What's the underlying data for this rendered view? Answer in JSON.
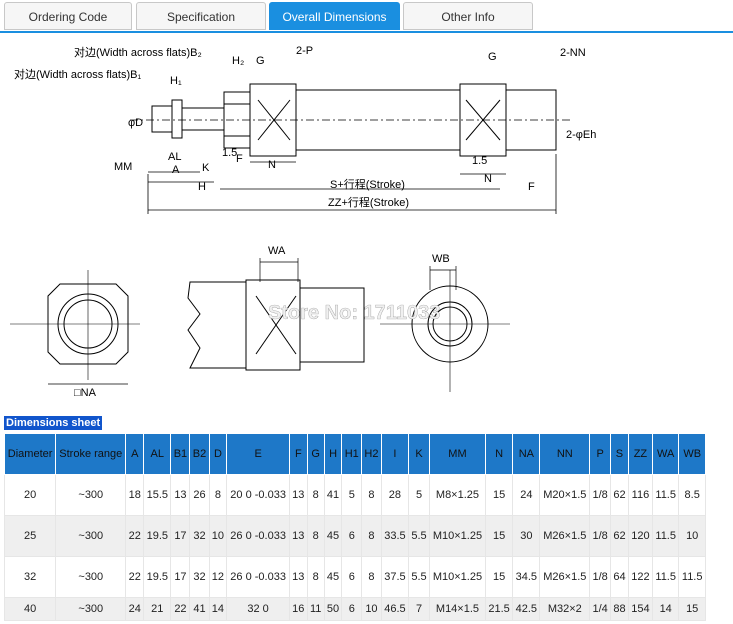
{
  "tabs": [
    {
      "label": "Ordering Code"
    },
    {
      "label": "Specification"
    },
    {
      "label": "Overall Dimensions"
    },
    {
      "label": "Other Info"
    }
  ],
  "watermark": "Store No: 1711033",
  "drawing_labels": {
    "b2": "对边(Width across flats)B₂",
    "b1": "对边(Width across flats)B₁",
    "h2": "H₂",
    "g": "G",
    "p": "2-P",
    "nn": "2-NN",
    "h1": "H₁",
    "d": "φD",
    "eh": "2-φEh",
    "mm": "MM",
    "al": "AL",
    "a": "A",
    "k": "K",
    "h": "H",
    "f": "F",
    "n": "N",
    "v15": "1.5",
    "s": "S+行程(Stroke)",
    "zz": "ZZ+行程(Stroke)",
    "wa": "WA",
    "wb": "WB",
    "na": "□NA"
  },
  "sheet_title": "Dimensions sheet",
  "table": {
    "headers": [
      "Diameter",
      "Stroke range",
      "A",
      "AL",
      "B1",
      "B2",
      "D",
      "E",
      "F",
      "G",
      "H",
      "H1",
      "H2",
      "I",
      "K",
      "MM",
      "N",
      "NA",
      "NN",
      "P",
      "S",
      "ZZ",
      "WA",
      "WB"
    ],
    "rows": [
      {
        "c": [
          "20",
          "~300",
          "18",
          "15.5",
          "13",
          "26",
          "8",
          "20 0 -0.033",
          "13",
          "8",
          "41",
          "5",
          "8",
          "28",
          "5",
          "M8×1.25",
          "15",
          "24",
          "M20×1.5",
          "1/8",
          "62",
          "116",
          "11.5",
          "8.5"
        ]
      },
      {
        "c": [
          "25",
          "~300",
          "22",
          "19.5",
          "17",
          "32",
          "10",
          "26 0 -0.033",
          "13",
          "8",
          "45",
          "6",
          "8",
          "33.5",
          "5.5",
          "M10×1.25",
          "15",
          "30",
          "M26×1.5",
          "1/8",
          "62",
          "120",
          "11.5",
          "10"
        ]
      },
      {
        "c": [
          "32",
          "~300",
          "22",
          "19.5",
          "17",
          "32",
          "12",
          "26 0 -0.033",
          "13",
          "8",
          "45",
          "6",
          "8",
          "37.5",
          "5.5",
          "M10×1.25",
          "15",
          "34.5",
          "M26×1.5",
          "1/8",
          "64",
          "122",
          "11.5",
          "11.5"
        ]
      },
      {
        "c": [
          "40",
          "~300",
          "24",
          "21",
          "22",
          "41",
          "14",
          "32 0",
          "16",
          "11",
          "50",
          "6",
          "10",
          "46.5",
          "7",
          "M14×1.5",
          "21.5",
          "42.5",
          "M32×2",
          "1/4",
          "88",
          "154",
          "14",
          "15"
        ]
      }
    ]
  }
}
